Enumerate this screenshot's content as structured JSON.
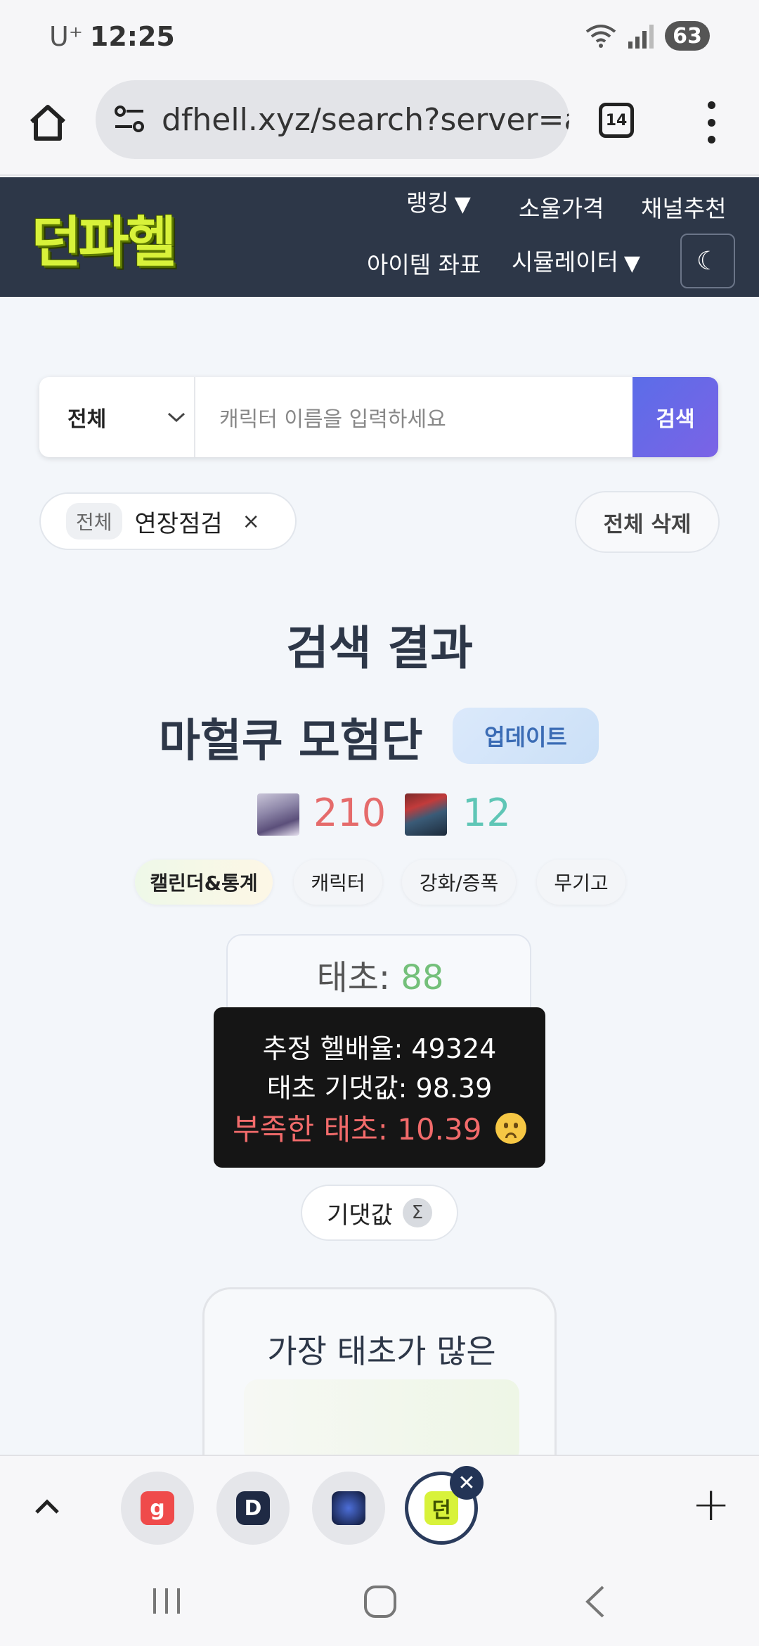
{
  "status_bar": {
    "carrier": "U⁺",
    "time": "12:25",
    "battery": "63"
  },
  "browser": {
    "url": "dfhell.xyz/search?server=ac",
    "tab_count": "14"
  },
  "site": {
    "logo": "던파헬",
    "nav": {
      "ranking": "랭킹",
      "soul_price": "소울가격",
      "channel": "채널추천",
      "item_coords": "아이템 좌표",
      "simulator": "시뮬레이터",
      "dark_mode_icon": "☾"
    }
  },
  "search": {
    "server": "전체",
    "placeholder": "캐릭터 이름을 입력하세요",
    "button": "검색"
  },
  "recent": {
    "server": "전체",
    "name": "연장점검",
    "close": "×",
    "clear_all": "전체 삭제"
  },
  "results": {
    "title": "검색 결과",
    "guild": "마헐쿠 모험단",
    "update": "업데이트",
    "count_a": "210",
    "count_b": "12",
    "tabs": [
      "캘린더&통계",
      "캐릭터",
      "강화/증폭",
      "무기고"
    ],
    "stat_label": "태초: ",
    "stat_value": "88"
  },
  "tooltip": {
    "line1": "추정 헬배율: 49324",
    "line2": "태초 기댓값: 98.39",
    "line3": "부족한 태초: 10.39"
  },
  "expect_button": {
    "label": "기댓값",
    "sigma": "Σ"
  },
  "most_card": {
    "title": "가장 태초가 많은"
  },
  "tabstrip": {
    "plus": "+",
    "close": "✕",
    "tab_g": "g",
    "tab_d": "D",
    "tab_logo": "던"
  },
  "colors": {
    "header_bg": "#2d3748",
    "accent": "#5b6de8",
    "count_a": "#e56b6b",
    "count_b": "#5fc6b6",
    "stat_value": "#74c07a",
    "warn": "#f26b6b"
  }
}
